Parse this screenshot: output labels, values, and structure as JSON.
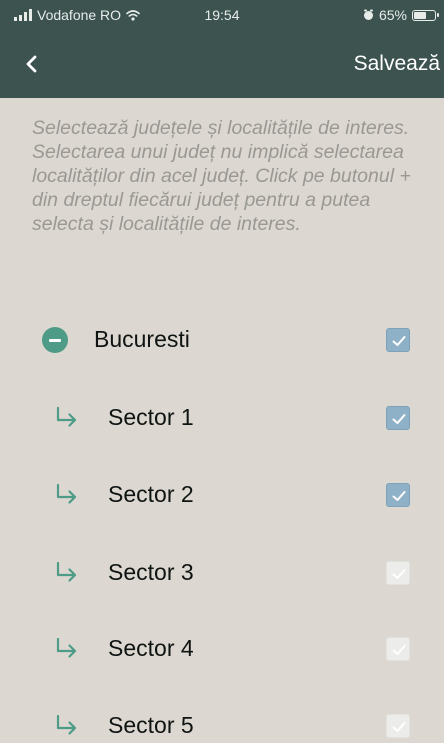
{
  "status_bar": {
    "carrier": "Vodafone RO",
    "time": "19:54",
    "battery_percent": "65%",
    "battery_level": 0.65,
    "icons": [
      "signal-icon",
      "wifi-icon",
      "alarm-icon",
      "battery-icon"
    ]
  },
  "header": {
    "back_icon": "chevron-left-icon",
    "save_label": "Salvează"
  },
  "instructions": "Selectează județele și localitățile de interes. Selectarea unui județ nu implică selectarea localităților din acel județ. Click pe butonul + din dreptul fiecărui județ pentru a putea selecta și localitățile de interes.",
  "county": {
    "name": "Bucuresti",
    "expanded": true,
    "icon": "collapse-minus-icon",
    "checked": true
  },
  "localities": [
    {
      "name": "Sector 1",
      "checked": true
    },
    {
      "name": "Sector 2",
      "checked": true
    },
    {
      "name": "Sector 3",
      "checked": false
    },
    {
      "name": "Sector 4",
      "checked": false
    },
    {
      "name": "Sector 5",
      "checked": false
    }
  ],
  "colors": {
    "header_bg": "#3c5350",
    "page_bg": "#dcd8d1",
    "accent_green": "#4e9b87",
    "checkbox_checked": "#8fb1c8",
    "checkbox_unchecked": "#ececea",
    "instruction_text": "#9a9894"
  }
}
